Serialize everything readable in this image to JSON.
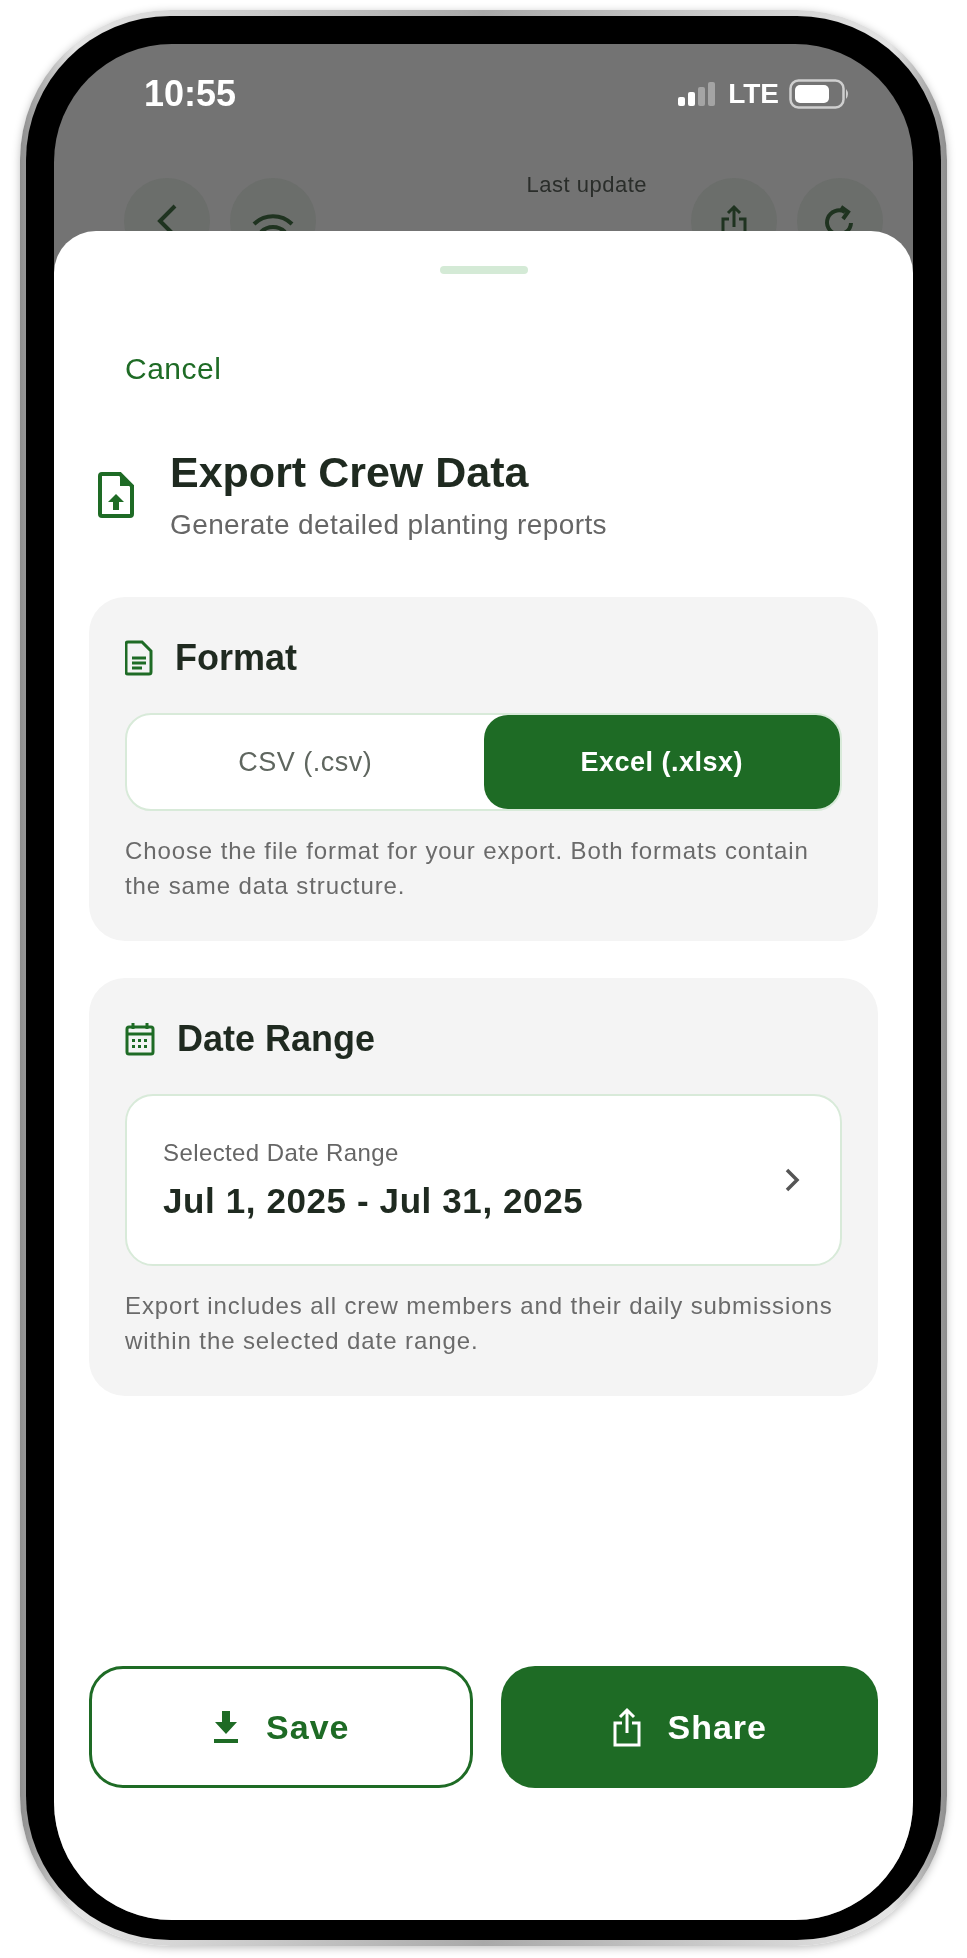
{
  "status_bar": {
    "time": "10:55",
    "network": "LTE"
  },
  "background": {
    "last_update_label": "Last update"
  },
  "sheet": {
    "cancel": "Cancel",
    "title": "Export Crew Data",
    "subtitle": "Generate detailed planting reports",
    "format": {
      "heading": "Format",
      "options": [
        {
          "label": "CSV (.csv)",
          "selected": false
        },
        {
          "label": "Excel (.xlsx)",
          "selected": true
        }
      ],
      "help": "Choose the file format for your export. Both formats contain the same data structure."
    },
    "date_range": {
      "heading": "Date Range",
      "field_label": "Selected Date Range",
      "value": "Jul 1, 2025 - Jul 31, 2025",
      "help": "Export includes all crew members and their daily submissions within the selected date range."
    },
    "actions": [
      {
        "label": "Save",
        "kind": "outline"
      },
      {
        "label": "Share",
        "kind": "filled"
      }
    ]
  }
}
